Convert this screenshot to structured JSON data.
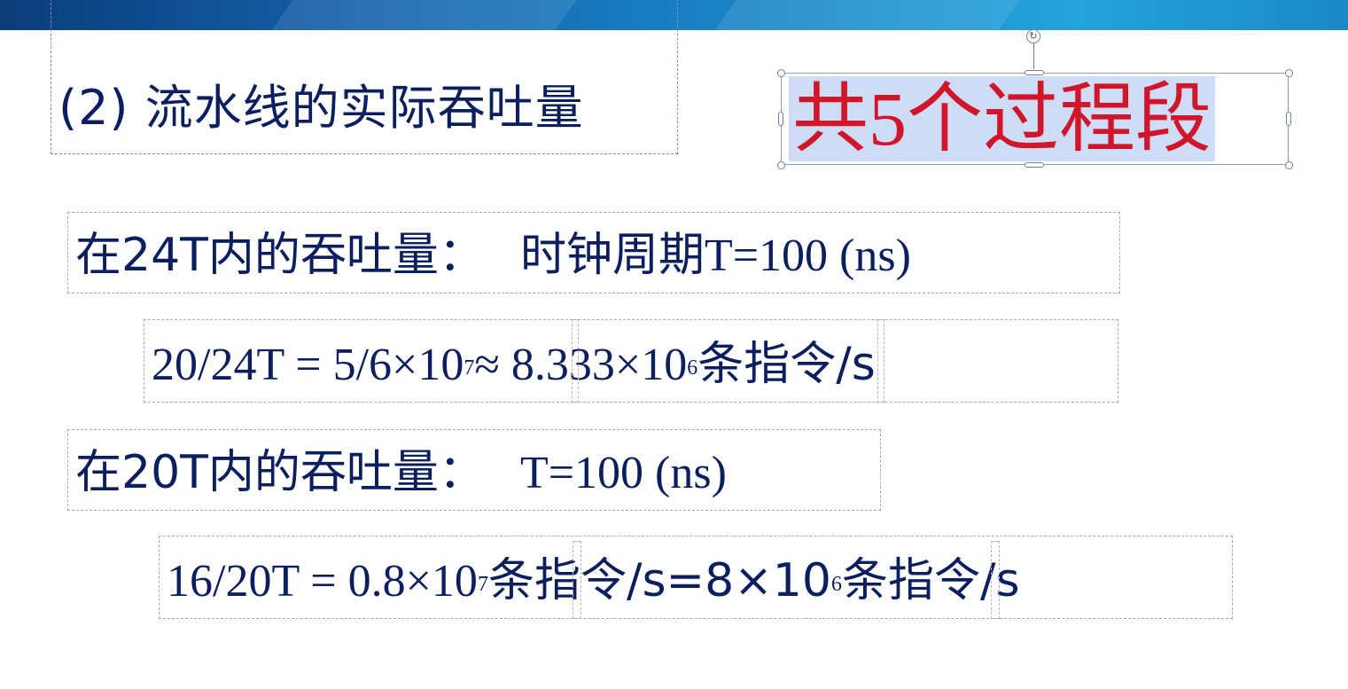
{
  "heading": {
    "title": "(2) 流水线的实际吞吐量"
  },
  "callout": {
    "text": "共5个过程段"
  },
  "line1": {
    "label": "在24T内的吞吐量：",
    "clock": "时钟周期T=100 (ns)"
  },
  "line2": {
    "part_a": "20/24T = 5/6×10",
    "exp_a": "7",
    "part_b": "≈ 8.333×10",
    "exp_b": "6",
    "unit": "条指令/s"
  },
  "line3": {
    "label": "在20T内的吞吐量：",
    "clock": "T=100 (ns)"
  },
  "line4": {
    "part_a": "16/20T = 0.8×10",
    "exp_a": "7",
    "part_b": "条指令/s=8×10",
    "exp_b": "6",
    "unit": "条指令/s"
  },
  "colors": {
    "text": "#0b1f5e",
    "callout_text": "#d0162a",
    "selection": "#cfdcf5",
    "banner": "#1a84c7"
  }
}
